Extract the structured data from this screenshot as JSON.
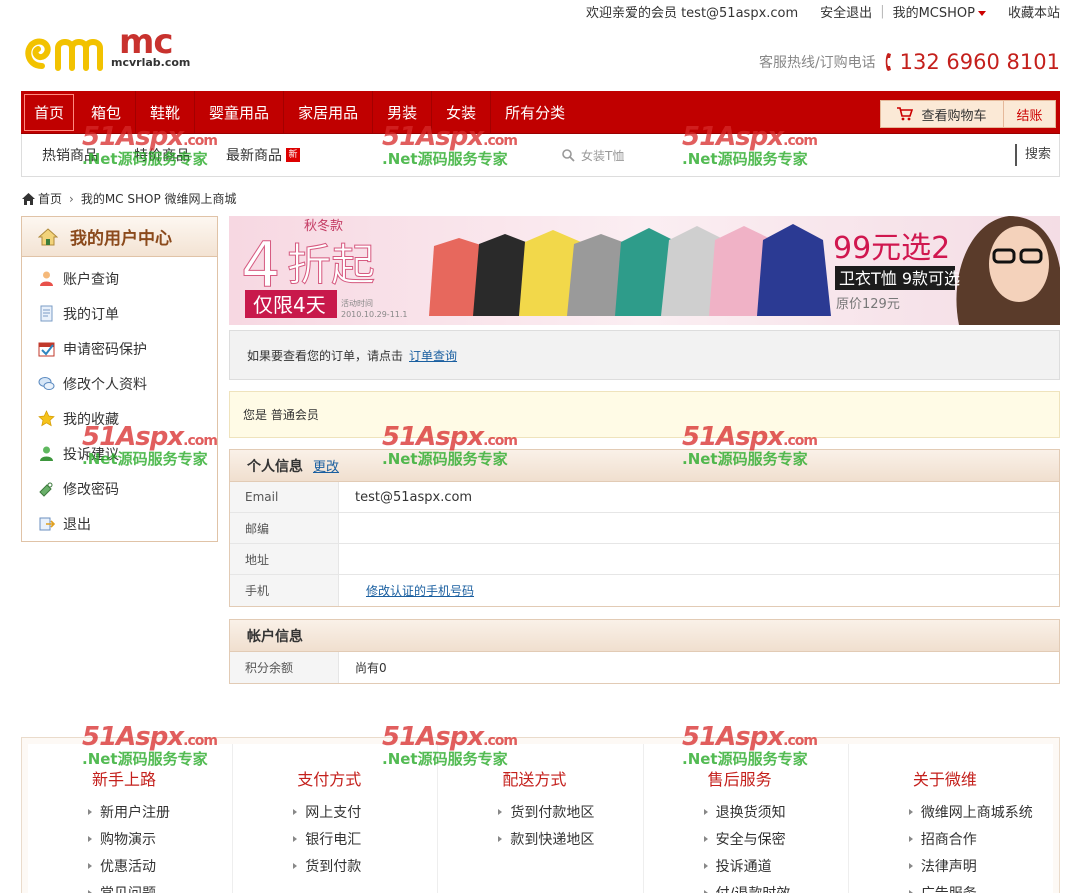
{
  "topbar": {
    "welcome": "欢迎亲爱的会员 test@51aspx.com",
    "logout": "安全退出",
    "my_shop": "我的MCSHOP",
    "bookmark": "收藏本站"
  },
  "logo": {
    "text": "mc",
    "sub": "mcvrlab.com"
  },
  "hotline": {
    "label": "客服热线/订购电话",
    "number": "132 6960 8101"
  },
  "nav": {
    "items": [
      "首页",
      "箱包",
      "鞋靴",
      "婴童用品",
      "家居用品",
      "男装",
      "女装",
      "所有分类"
    ],
    "cart_label": "查看购物车",
    "checkout_label": "结账"
  },
  "subnav": {
    "items": [
      "热销商品",
      "特价商品",
      "最新商品"
    ],
    "new_badge": "新",
    "search_hint": "女装T恤",
    "search_button": "搜索"
  },
  "breadcrumb": {
    "home": "首页",
    "current": "我的MC SHOP 微维网上商城"
  },
  "sidebar": {
    "title": "我的用户中心",
    "items": [
      "账户查询",
      "我的订单",
      "申请密码保护",
      "修改个人资料",
      "我的收藏",
      "投诉建议",
      "修改密码",
      "退出"
    ]
  },
  "banner": {
    "season": "秋冬款",
    "discount_number": "4",
    "discount_text": "折起",
    "limit": "仅限4天",
    "activity_label": "活动时间",
    "date": "2010.10.29-11.1",
    "promo_price": "99元选2",
    "promo_sub": "卫衣T恤 9款可选",
    "original_price": "原价129元"
  },
  "notice_order": {
    "text": "如果要查看您的订单，请点击",
    "link": "订单查询"
  },
  "notice_member": {
    "text": "您是 普通会员"
  },
  "personal": {
    "title": "个人信息",
    "edit": "更改",
    "rows": [
      {
        "label": "Email",
        "value": "test@51aspx.com"
      },
      {
        "label": "邮编",
        "value": ""
      },
      {
        "label": "地址",
        "value": ""
      },
      {
        "label": "手机",
        "value": "",
        "link": "修改认证的手机号码"
      }
    ]
  },
  "account": {
    "title": "帐户信息",
    "rows": [
      {
        "label": "积分余额",
        "value": "尚有0"
      }
    ]
  },
  "footer": {
    "columns": [
      {
        "title": "新手上路",
        "items": [
          "新用户注册",
          "购物演示",
          "优惠活动",
          "常见问题"
        ]
      },
      {
        "title": "支付方式",
        "items": [
          "网上支付",
          "银行电汇",
          "货到付款"
        ]
      },
      {
        "title": "配送方式",
        "items": [
          "货到付款地区",
          "款到快递地区"
        ]
      },
      {
        "title": "售后服务",
        "items": [
          "退换货须知",
          "安全与保密",
          "投诉通道",
          "付/退款时效"
        ]
      },
      {
        "title": "关于微维",
        "items": [
          "微维网上商城系统",
          "招商合作",
          "法律声明",
          "广告服务"
        ]
      }
    ]
  },
  "watermark": {
    "brand": "51Aspx",
    "domain": ".com",
    "tagline": ".Net源码服务专家"
  }
}
